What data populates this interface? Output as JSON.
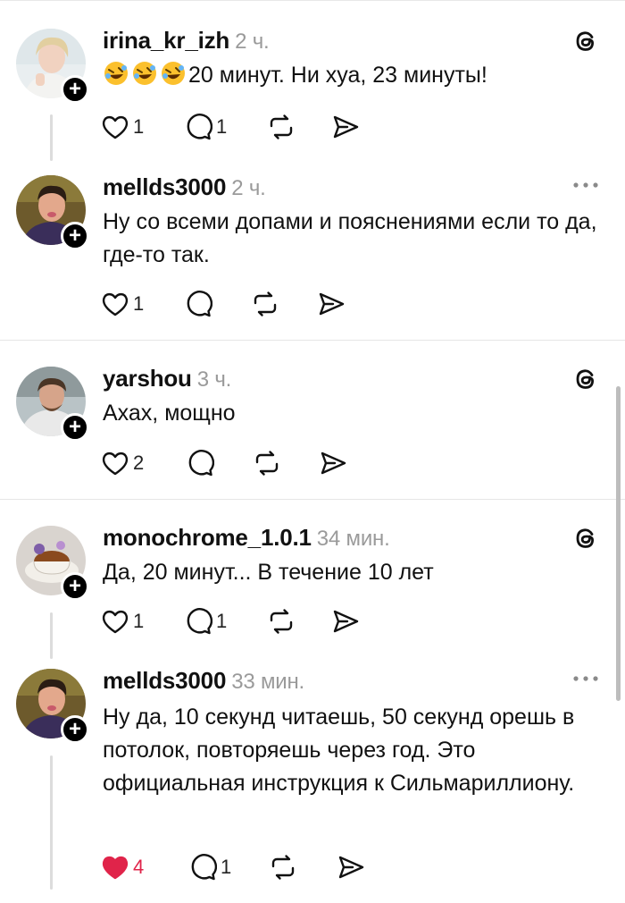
{
  "posts": [
    {
      "username": "irina_kr_izh",
      "time": "2 ч.",
      "text": "20 минут. Ни хуа, 23 минуты!",
      "emoji_prefix": [
        "rolling-laughing-emoji",
        "rolling-laughing-emoji",
        "rolling-laughing-emoji"
      ],
      "corner_icon": "threads-logo-icon",
      "likes": "1",
      "replies": "1",
      "liked": false
    },
    {
      "username": "mellds3000",
      "time": "2 ч.",
      "text": "Ну со всеми допами и пояснениями если то да, где-то так.",
      "corner_icon": "more-options-icon",
      "likes": "1",
      "replies": "",
      "liked": false
    },
    {
      "username": "yarshou",
      "time": "3 ч.",
      "text": "Ахах, мощно",
      "corner_icon": "threads-logo-icon",
      "likes": "2",
      "replies": "",
      "liked": false
    },
    {
      "username": "monochrome_1.0.1",
      "time": "34 мин.",
      "text": "Да, 20 минут... В течение 10 лет",
      "corner_icon": "threads-logo-icon",
      "likes": "1",
      "replies": "1",
      "liked": false
    },
    {
      "username": "mellds3000",
      "time": "33 мин.",
      "text": "Ну да, 10 секунд читаешь, 50 секунд орешь в потолок, повторяешь через год. Это официальная инструкция к Сильмариллиону.",
      "corner_icon": "more-options-icon",
      "likes": "4",
      "replies": "1",
      "liked": true
    }
  ],
  "colors": {
    "like_active": "#e0244a",
    "time": "#9a9a9a",
    "divider": "#e6e6e6"
  }
}
